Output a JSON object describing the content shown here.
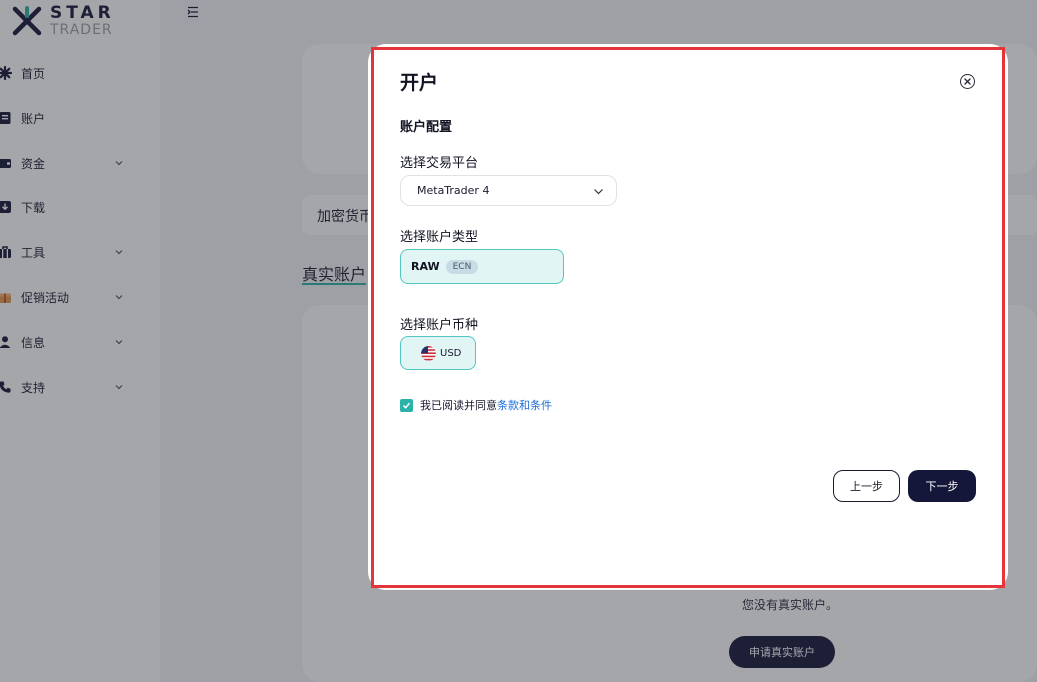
{
  "brand": {
    "name_top": "STAR",
    "name_bottom": "TRADER",
    "accent": "#2bb3a7",
    "navy": "#15173a"
  },
  "sidebar": {
    "items": [
      {
        "label": "首页",
        "icon": "home-icon",
        "expandable": false
      },
      {
        "label": "账户",
        "icon": "account-icon",
        "expandable": false
      },
      {
        "label": "资金",
        "icon": "wallet-icon",
        "expandable": true
      },
      {
        "label": "下载",
        "icon": "download-icon",
        "expandable": false
      },
      {
        "label": "工具",
        "icon": "toolbox-icon",
        "expandable": true
      },
      {
        "label": "促销活动",
        "icon": "gift-icon",
        "expandable": true
      },
      {
        "label": "信息",
        "icon": "user-icon",
        "expandable": true
      },
      {
        "label": "支持",
        "icon": "phone-icon",
        "expandable": true
      }
    ]
  },
  "background": {
    "filter_chip": "加密货币",
    "tab_live": "真实账户",
    "empty_text": "您没有真实账户。",
    "apply_button": "申请真实账户"
  },
  "modal": {
    "title": "开户",
    "section_title": "账户配置",
    "platform_label": "选择交易平台",
    "platform_value": "MetaTrader 4",
    "account_type_label": "选择账户类型",
    "account_type": {
      "name": "RAW",
      "badge": "ECN"
    },
    "currency_label": "选择账户币种",
    "currency": {
      "code": "USD",
      "flag": "us-flag-icon"
    },
    "agree": {
      "checked": true,
      "text": "我已阅读并同意",
      "link": "条款和条件"
    },
    "prev_button": "上一步",
    "next_button": "下一步",
    "highlight_color": "#e5343a"
  }
}
